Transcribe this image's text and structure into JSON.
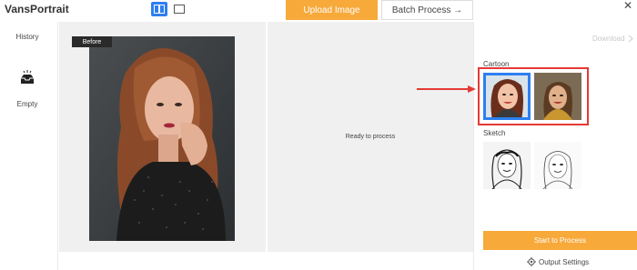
{
  "app": {
    "title": "VansPortrait"
  },
  "toolbar": {
    "upload_label": "Upload Image",
    "batch_label": "Batch Process →",
    "close_glyph": "✕",
    "view_modes": [
      "split-view-icon",
      "single-view-icon"
    ],
    "active_view": "split-view-icon"
  },
  "sidebar": {
    "history_label": "History",
    "empty_label": "Empty"
  },
  "canvas": {
    "before_badge": "Before",
    "after_status": "Ready to process"
  },
  "panel": {
    "download_label": "Download",
    "sections": [
      {
        "label": "Cartoon",
        "styles": [
          "cartoon-style-1",
          "cartoon-style-2"
        ],
        "selected": "cartoon-style-1"
      },
      {
        "label": "Sketch",
        "styles": [
          "sketch-style-1",
          "sketch-style-2"
        ]
      }
    ],
    "start_label": "Start to Process",
    "output_settings_label": "Output Settings"
  },
  "colors": {
    "accent_orange": "#f7a93a",
    "accent_blue": "#2d7ff0",
    "highlight_red": "#e53935"
  }
}
